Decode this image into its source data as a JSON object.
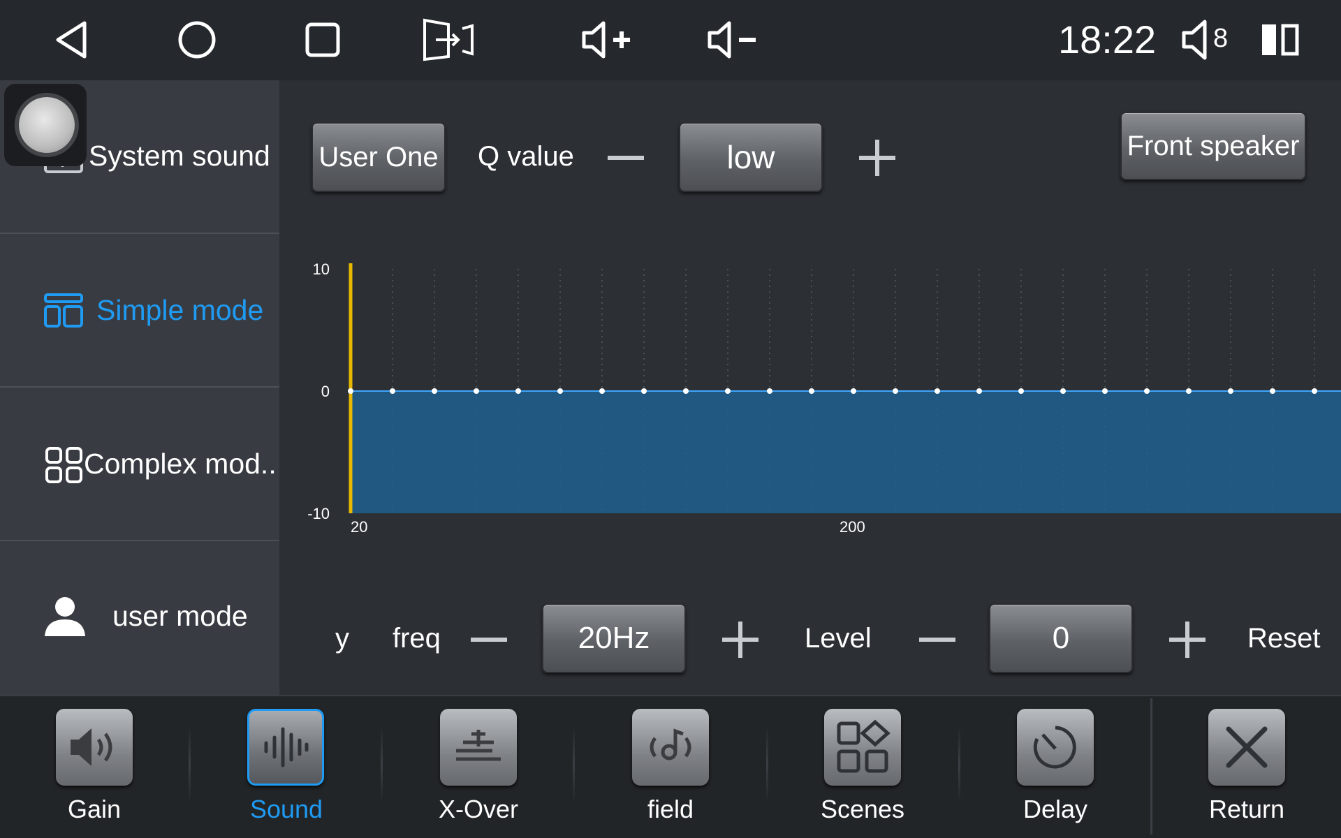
{
  "status_bar": {
    "clock": "18:22",
    "volume_level": "8"
  },
  "sidebar": {
    "items": [
      {
        "label": "System sound",
        "icon": "waveform-icon",
        "active": false
      },
      {
        "label": "Simple mode",
        "icon": "simple-layout-icon",
        "active": true
      },
      {
        "label": "Complex mod..",
        "icon": "grid-icon",
        "active": false
      },
      {
        "label": "user mode",
        "icon": "user-icon",
        "active": false
      }
    ]
  },
  "top_controls": {
    "preset_label": "User One",
    "q_label": "Q value",
    "q_value": "low",
    "speaker_label": "Front speaker"
  },
  "eq_controls": {
    "partial_label": "cy",
    "freq_label": "freq",
    "freq_value": "20Hz",
    "level_label": "Level",
    "level_value": "0",
    "reset_label": "Reset"
  },
  "chart_data": {
    "type": "line",
    "y_ticks": [
      "10",
      "0",
      "-10"
    ],
    "x_ticks": [
      "20",
      "200"
    ],
    "ylim": [
      -10,
      10
    ],
    "points": 24,
    "values": [
      0,
      0,
      0,
      0,
      0,
      0,
      0,
      0,
      0,
      0,
      0,
      0,
      0,
      0,
      0,
      0,
      0,
      0,
      0,
      0,
      0,
      0,
      0,
      0
    ],
    "selected_index": 0,
    "colors": {
      "fill": "#1f5f8f",
      "line": "#3fa7ff",
      "cursor": "#e6b800"
    }
  },
  "bottom_tabs": [
    {
      "label": "Gain",
      "icon": "speaker-gain-icon",
      "active": false
    },
    {
      "label": "Sound",
      "icon": "sound-wave-icon",
      "active": true
    },
    {
      "label": "X-Over",
      "icon": "crossover-icon",
      "active": false
    },
    {
      "label": "field",
      "icon": "sound-field-icon",
      "active": false
    },
    {
      "label": "Scenes",
      "icon": "scenes-icon",
      "active": false
    },
    {
      "label": "Delay",
      "icon": "delay-icon",
      "active": false
    },
    {
      "label": "Return",
      "icon": "close-icon",
      "active": false
    }
  ],
  "colors": {
    "accent": "#1f9bf3",
    "background": "#2c3035",
    "sidebar": "#383c42"
  }
}
